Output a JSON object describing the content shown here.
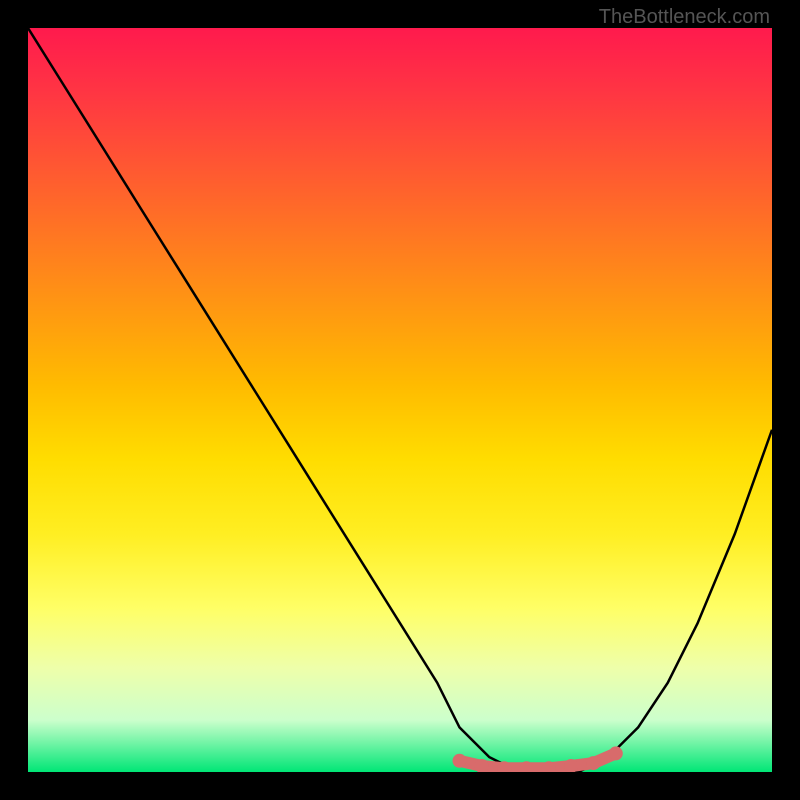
{
  "watermark": "TheBottleneck.com",
  "chart_data": {
    "type": "line",
    "title": "",
    "xlabel": "",
    "ylabel": "",
    "xlim": [
      0,
      100
    ],
    "ylim": [
      0,
      100
    ],
    "background": "rainbow-gradient-vertical",
    "series": [
      {
        "name": "bottleneck-curve",
        "color": "#000000",
        "x": [
          0,
          5,
          10,
          15,
          20,
          25,
          30,
          35,
          40,
          45,
          50,
          55,
          58,
          62,
          66,
          70,
          74,
          78,
          82,
          86,
          90,
          95,
          100
        ],
        "y": [
          100,
          92,
          84,
          76,
          68,
          60,
          52,
          44,
          36,
          28,
          20,
          12,
          6,
          2,
          0,
          0,
          0,
          2,
          6,
          12,
          20,
          32,
          46
        ]
      },
      {
        "name": "highlight-region",
        "color": "#d86b6b",
        "type": "markers",
        "x": [
          58,
          61,
          64,
          67,
          70,
          73,
          76,
          79
        ],
        "y": [
          1.5,
          0.8,
          0.5,
          0.5,
          0.5,
          0.8,
          1.2,
          2.5
        ]
      }
    ]
  }
}
